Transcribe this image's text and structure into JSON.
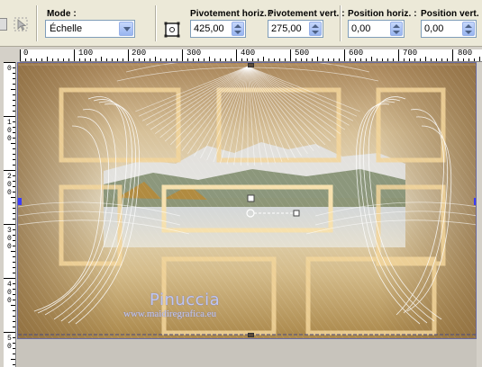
{
  "toolbar": {
    "mode_label": "Mode :",
    "mode_value": "Échelle",
    "pivot_h_label": "Pivotement horiz. :",
    "pivot_h_value": "425,00",
    "pivot_v_label": "Pivotement vert. :",
    "pivot_v_value": "275,00",
    "pos_h_label": "Position horiz. :",
    "pos_h_value": "0,00",
    "pos_v_label": "Position vert. :",
    "pos_v_value": "0,00"
  },
  "ruler": {
    "top": [
      "0",
      "100",
      "200",
      "300",
      "400",
      "500",
      "600",
      "700",
      "800"
    ],
    "left": [
      "0",
      "1\n0\n0",
      "2\n0\n0",
      "3\n0\n0",
      "4\n0\n0",
      "5\n0"
    ]
  },
  "canvas": {
    "watermark_name": "Pinuccia",
    "watermark_url": "www.maidiregrafica.eu"
  },
  "colors": {
    "toolbar_bg": "#ece9d8",
    "spin_button": "#98b5f0",
    "canvas_gold": "#c9a86a",
    "frame_gold": "#f3d59a"
  },
  "icons": [
    "pick-tool-icon",
    "pivot-icon",
    "dropdown-arrow-icon",
    "spin-arrows-icon"
  ]
}
